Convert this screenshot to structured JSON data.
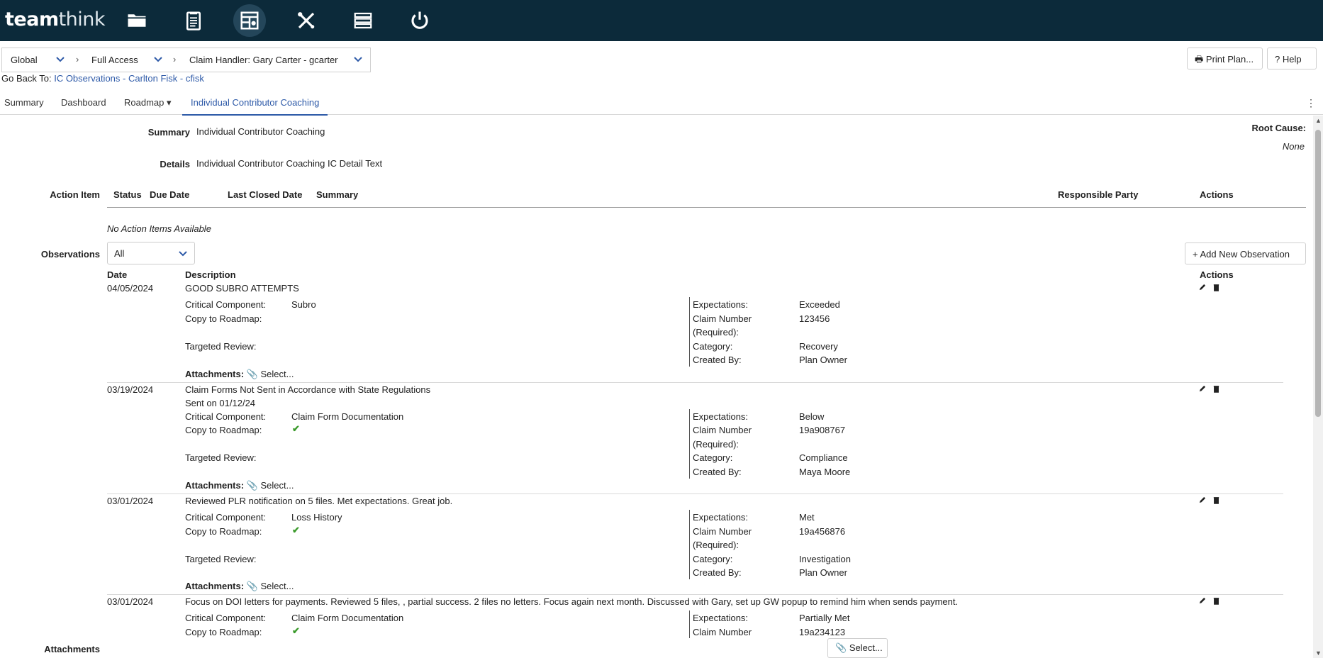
{
  "app": {
    "logo_bold": "team",
    "logo_rest": "think"
  },
  "toolbar_icons": [
    "folder-icon",
    "clipboard-icon",
    "dashboard-icon",
    "tools-icon",
    "layers-icon",
    "power-icon"
  ],
  "breadcrumb": {
    "scope": "Global",
    "access": "Full Access",
    "user": "Claim Handler: Gary Carter - gcarter"
  },
  "buttons": {
    "print": "Print Plan...",
    "help": "Help"
  },
  "go_back": {
    "prefix": "Go Back To:",
    "link": "IC Observations - Carlton Fisk - cfisk"
  },
  "tabs": {
    "summary": "Summary",
    "dashboard": "Dashboard",
    "roadmap": "Roadmap",
    "coaching": "Individual Contributor Coaching"
  },
  "summary": {
    "label": "Summary",
    "value": "Individual Contributor Coaching"
  },
  "details": {
    "label": "Details",
    "value": "Individual Contributor Coaching IC Detail Text"
  },
  "root_cause": {
    "label": "Root Cause:",
    "value": "None"
  },
  "action_items": {
    "label": "Action Item",
    "headers": {
      "status": "Status",
      "due": "Due Date",
      "closed": "Last Closed Date",
      "summary": "Summary",
      "party": "Responsible Party",
      "actions": "Actions"
    },
    "empty": "No Action Items Available"
  },
  "observations": {
    "label": "Observations",
    "filter": "All",
    "add_button": "Add New Observation",
    "headers": {
      "date": "Date",
      "description": "Description",
      "actions": "Actions"
    },
    "field_labels": {
      "critical": "Critical Component:",
      "copy": "Copy to Roadmap:",
      "targeted": "Targeted Review:",
      "attachments": "Attachments:",
      "expectations": "Expectations:",
      "claim": "Claim Number",
      "required": "(Required):",
      "category": "Category:",
      "created": "Created By:",
      "select": "Select..."
    },
    "rows": [
      {
        "date": "04/05/2024",
        "description": "GOOD SUBRO ATTEMPTS",
        "description2": "",
        "critical": "Subro",
        "expectations": "Exceeded",
        "claim": "123456",
        "category": "Recovery",
        "created": "Plan Owner"
      },
      {
        "date": "03/19/2024",
        "description": "Claim Forms Not Sent in Accordance with State Regulations",
        "description2": "Sent on 01/12/24",
        "critical": "Claim Form Documentation",
        "expectations": "Below",
        "claim": "19a908767",
        "category": "Compliance",
        "created": "Maya Moore"
      },
      {
        "date": "03/01/2024",
        "description": "Reviewed PLR notification on 5 files. Met expectations. Great job.",
        "description2": "",
        "critical": "Loss History",
        "expectations": "Met",
        "claim": "19a456876",
        "category": "Investigation",
        "created": "Plan Owner"
      },
      {
        "date": "03/01/2024",
        "description": "Focus on DOI letters for payments. Reviewed 5 files, , partial success. 2 files no letters. Focus again next month. Discussed with Gary, set up GW popup to remind him when sends payment.",
        "description2": "",
        "critical": "Claim Form Documentation",
        "expectations": "Partially Met",
        "claim": "19a234123",
        "category": "",
        "created": ""
      }
    ]
  },
  "attachments_section": {
    "label": "Attachments",
    "select": "Select..."
  }
}
